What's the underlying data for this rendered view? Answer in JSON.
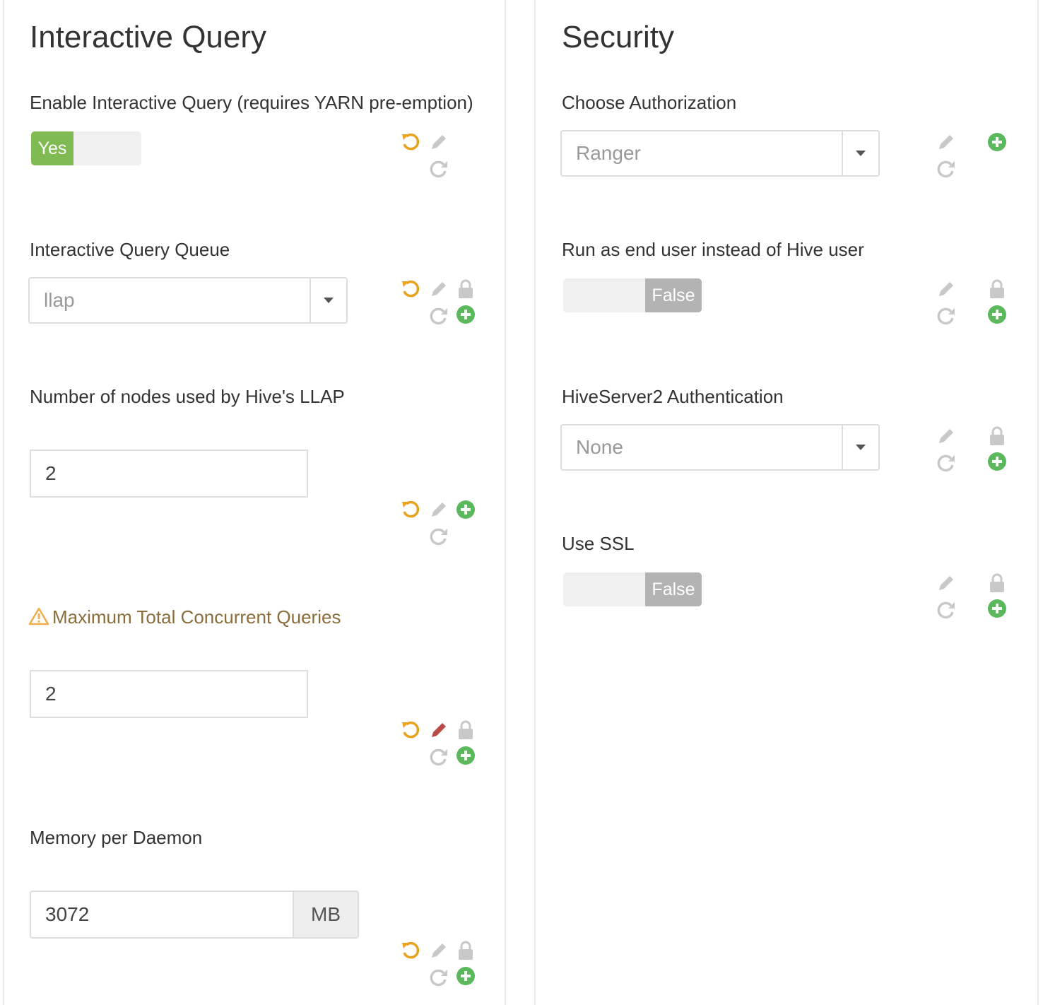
{
  "left": {
    "title": "Interactive Query",
    "enable_iq": {
      "label": "Enable Interactive Query (requires YARN pre-emption)",
      "value": "Yes"
    },
    "iq_queue": {
      "label": "Interactive Query Queue",
      "value": "llap"
    },
    "llap_nodes": {
      "label": "Number of nodes used by Hive's LLAP",
      "value": "2"
    },
    "max_queries": {
      "label": "Maximum Total Concurrent Queries",
      "value": "2"
    },
    "memory": {
      "label": "Memory per Daemon",
      "value": "3072",
      "unit": "MB"
    }
  },
  "right": {
    "title": "Security",
    "authorization": {
      "label": "Choose Authorization",
      "value": "Ranger"
    },
    "run_as": {
      "label": "Run as end user instead of Hive user",
      "value": "False"
    },
    "hs2_auth": {
      "label": "HiveServer2 Authentication",
      "value": "None"
    },
    "ssl": {
      "label": "Use SSL",
      "value": "False"
    }
  },
  "icons": {
    "undo": "undo-icon",
    "edit": "pencil-icon",
    "lock": "lock-icon",
    "refresh": "refresh-icon",
    "add": "plus-circle-icon",
    "warning": "warning-icon"
  },
  "colors": {
    "undo": "#e8a21b",
    "disabled": "#c8c8c8",
    "edit_active": "#b94a48",
    "add": "#5cb85c",
    "toggle_on": "#7fba52",
    "toggle_off": "#b3b3b3",
    "warning_text": "#8a6d3b"
  }
}
